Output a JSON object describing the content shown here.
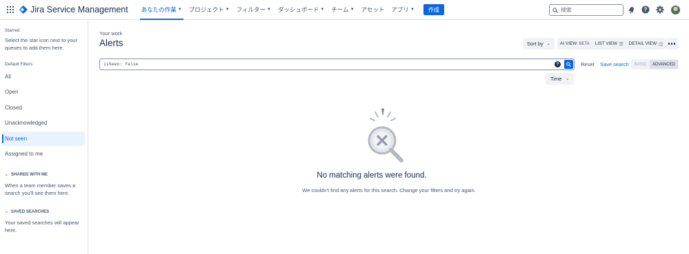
{
  "app": {
    "name": "Jira Service Management"
  },
  "nav": {
    "items": [
      {
        "label": "あなたの作業",
        "active": true
      },
      {
        "label": "プロジェクト",
        "active": false
      },
      {
        "label": "フィルター",
        "active": false
      },
      {
        "label": "ダッシュボード",
        "active": false
      },
      {
        "label": "チーム",
        "active": false
      },
      {
        "label": "アセット",
        "active": false,
        "no_chevron": true
      },
      {
        "label": "アプリ",
        "active": false
      }
    ],
    "create_label": "作成",
    "search_placeholder": "検索",
    "icons": [
      "notifications-icon",
      "help-icon",
      "settings-icon"
    ]
  },
  "sidebar": {
    "starred_heading": "Starred",
    "starred_text": "Select the star icon next to your queues to add them here.",
    "default_filters_heading": "Default Filters",
    "filters": [
      {
        "label": "All",
        "selected": false
      },
      {
        "label": "Open",
        "selected": false
      },
      {
        "label": "Closed",
        "selected": false
      },
      {
        "label": "Unacknowledged",
        "selected": false
      },
      {
        "label": "Not seen",
        "selected": true
      },
      {
        "label": "Assigned to me",
        "selected": false
      }
    ],
    "shared_heading": "SHARED WITH ME",
    "shared_text": "When a team member saves a search you'll see them here.",
    "saved_heading": "SAVED SEARCHES",
    "saved_text": "Your saved searches will appear here."
  },
  "main": {
    "breadcrumb": "Your work",
    "title": "Alerts",
    "sort_label": "Sort by",
    "views": {
      "ai_label": "AI VIEW",
      "ai_badge": "BETA",
      "list_label": "LIST VIEW",
      "detail_label": "DETAIL VIEW"
    },
    "query": "isSeen: false",
    "reset_label": "Reset",
    "save_search_label": "Save search",
    "mode_basic": "BASIC",
    "mode_advanced": "ADVANCED",
    "time_label": "Time",
    "empty_title": "No matching alerts were found.",
    "empty_desc": "We couldn't find any alerts for this search. Change your filters and try again."
  },
  "colors": {
    "accent": "#0c66e4",
    "text": "#172b4d",
    "subtle": "#44546f",
    "beta": "#5e4db2"
  }
}
